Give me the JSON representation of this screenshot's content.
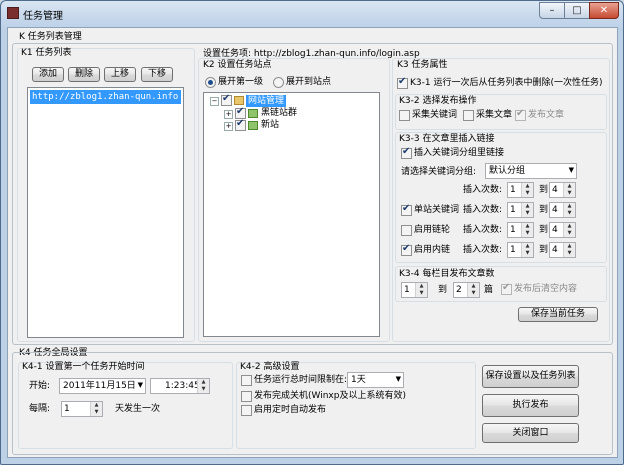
{
  "window": {
    "title": "任务管理",
    "min_glyph": "–",
    "max_glyph": "□",
    "close_glyph": "✕"
  },
  "k_section": {
    "title": "K 任务列表管理"
  },
  "k1": {
    "title": "K1 任务列表",
    "buttons": {
      "add": "添加",
      "delete": "删除",
      "up": "上移",
      "down": "下移"
    },
    "tasks": [
      "http://zblog1.zhan-qun.info"
    ]
  },
  "settings_label": "设置任务项: http://zblog1.zhan-qun.info/login.asp",
  "k2": {
    "title": "K2 设置任务站点",
    "radio_first": "展开第一级",
    "radio_site": "展开到站点",
    "tree": {
      "root": "网站管理",
      "child1": "黑链站群",
      "child2": "新站",
      "expander": "+",
      "collapser": "−"
    }
  },
  "k3": {
    "title": "K3 任务属性",
    "k3_1": "K3-1 运行一次后从任务列表中删除(一次性任务)",
    "k3_2": {
      "title": "K3-2 选择发布操作",
      "collect_keywords": "采集关键词",
      "collect_articles": "采集文章",
      "publish_articles": "发布文章"
    },
    "k3_3": {
      "title": "K3-3 在文章里插入链接",
      "insert_keyword_group": "插入关键词分组里链接",
      "select_group_label": "请选择关键词分组:",
      "group_value": "默认分组",
      "insert_times_label": "插入次数:",
      "to_label": "到",
      "row_group": {
        "from": "1",
        "to": "4"
      },
      "row_single": {
        "label": "单站关键词",
        "from": "1",
        "to": "4"
      },
      "row_chain": {
        "label": "启用链轮",
        "from": "1",
        "to": "4"
      },
      "row_internal": {
        "label": "启用内链",
        "from": "1",
        "to": "4"
      }
    },
    "k3_4": {
      "title": "K3-4 每栏目发布文章数",
      "from": "1",
      "to_label": "到",
      "to": "2",
      "unit": "篇",
      "clear_after": "发布后清空内容"
    },
    "save_task": "保存当前任务"
  },
  "k4": {
    "title": "K4 任务全局设置",
    "k4_1": {
      "title": "K4-1 设置第一个任务开始时间",
      "start_label": "开始:",
      "date": "2011年11月15日",
      "time": "1:23:45",
      "every_label": "每隔:",
      "every_value": "1",
      "every_suffix": "天发生一次"
    },
    "k4_2": {
      "title": "K4-2 高级设置",
      "limit_label": "任务运行总时间限制在:",
      "limit_value": "1天",
      "shutdown": "发布完成关机(Winxp及以上系统有效)",
      "autostart": "启用定时自动发布"
    },
    "buttons": {
      "save_all": "保存设置以及任务列表",
      "run": "执行发布",
      "close": "关闭窗口"
    }
  }
}
